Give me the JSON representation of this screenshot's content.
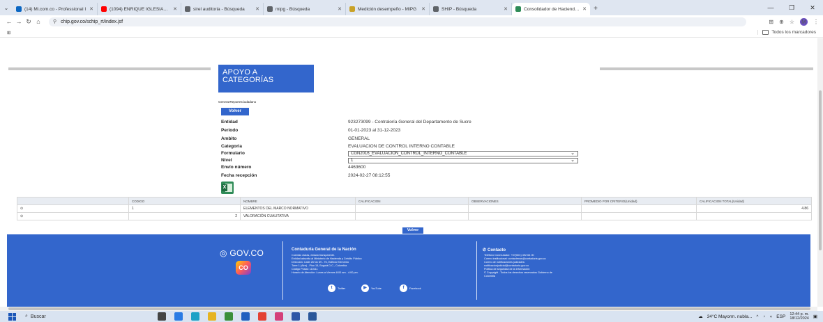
{
  "browser": {
    "tabs": [
      {
        "label": "(14) Mi.com.co - Professional I",
        "favicon_color": "#0a66c2"
      },
      {
        "label": "(1094) ENRIQUE IGLESIAS MIX",
        "favicon_color": "#ff0000"
      },
      {
        "label": "sirel auditoria - Búsqueda",
        "favicon_color": "#5f6368"
      },
      {
        "label": "mipg - Búsqueda",
        "favicon_color": "#5f6368"
      },
      {
        "label": "Medición desempeño - MIPG",
        "favicon_color": "#c9a227"
      },
      {
        "label": "SHIP - Búsqueda",
        "favicon_color": "#5f6368"
      },
      {
        "label": "Consolidador de Hacienda e Inf",
        "favicon_color": "#2e8b57",
        "active": true
      }
    ],
    "url": "chip.gov.co/schip_rt/index.jsf",
    "profile_initial": "M",
    "bookmarks_label": "Todos los marcadores"
  },
  "page": {
    "title_line1": "APOYO A",
    "title_line2": "CATEGORÍAS",
    "sub_label": "GenerarReporteCiudadano",
    "volver_label": "Volver",
    "fields": [
      {
        "label": "Entidad",
        "value": "923273099 - Contraloría General del Departamento de Sucre"
      },
      {
        "label": "Periodo",
        "value": "01-01-2023 al 31-12-2023"
      },
      {
        "label": "Ambito",
        "value": "GENERAL"
      },
      {
        "label": "Categoria",
        "value": "EVALUACION DE CONTROL INTERNO CONTABLE"
      },
      {
        "label": "Formulario",
        "value": "CGN2016_EVALUACION_CONTROL_INTERNO_CONTABLE"
      },
      {
        "label": "Nivel",
        "value": "1"
      },
      {
        "label": "Envío número",
        "value": "4463600"
      },
      {
        "label": "Fecha recepción",
        "value": "2024-02-27 08:12:55"
      }
    ],
    "table": {
      "headers": [
        "",
        "CODIGO",
        "NOMBRE",
        "CALIFICACION",
        "OBSERVACIONES",
        "PROMEDIO POR CRITERIO(Unidad)",
        "CALIFICACION TOTAL(Unidad)"
      ],
      "rows": [
        [
          "",
          "1",
          "ELEMENTOS DEL MARCO NORMATIVO",
          "",
          "",
          "",
          "4.86"
        ],
        [
          "",
          "2",
          "VALORACIÓN CUALITATIVA",
          "",
          "",
          "",
          ""
        ]
      ]
    }
  },
  "footer": {
    "gov_logo": "GOV.CO",
    "co_logo": "CO",
    "col1_title": "Contaduría General de la Nación",
    "col1_text": "Cuentas claras, estado transparente.\nEntidad adscrita al Ministerio de Hacienda y Crédito Público\nDirección: Calle 26 No 69 - 76, Edificio Elemento\nTorre 1 (Aire) - Piso 15, Bogotá D.C., Colombia\nCódigo Postal: 110111\nHorario de Atención: Lunes a Viernes 8:00 am - 4:00 pm.",
    "col2_title": "Contacto",
    "col2_text": "Teléfono Conmutador: +57(601) 492 64 00\nCorreo institucional: contactenos@contaduria.gov.co\nCorreo de notificaciones judiciales:\nnotificacionjudicial@contaduria.gov.co\nPolítica de seguridad de la información\n© Copyright - Todos los derechos reservados Gobierno de\nColombia",
    "social": [
      {
        "label": "Twitter",
        "glyph": "t"
      },
      {
        "label": "YouTube",
        "glyph": "▶"
      },
      {
        "label": "Facebook",
        "glyph": "f"
      }
    ]
  },
  "taskbar": {
    "search_placeholder": "Buscar",
    "weather": "34°C Mayorm. nubla...",
    "lang": "ESP",
    "time": "12:44 p. m.",
    "date": "18/12/2024"
  }
}
